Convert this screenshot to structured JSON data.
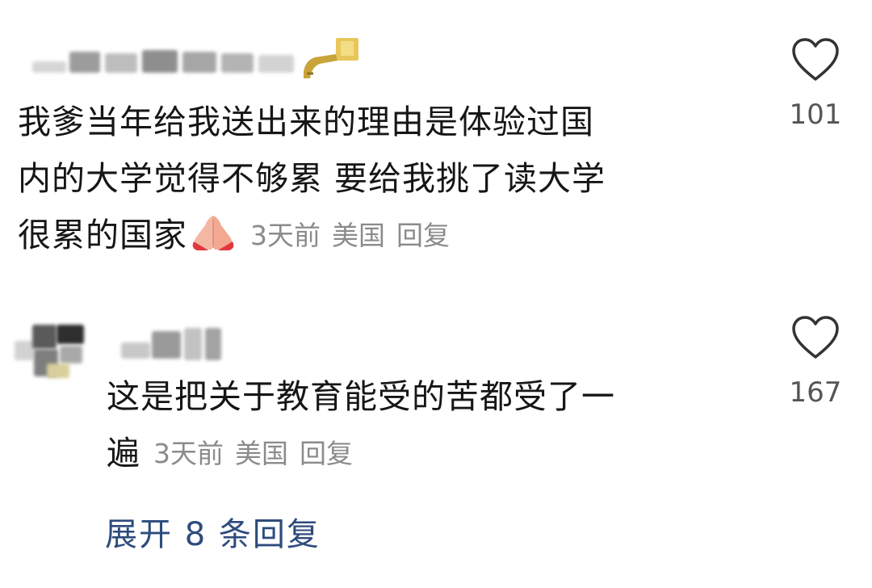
{
  "comments": [
    {
      "text_lines": [
        "我爹当年给我送出来的理由是体验过国",
        "内的大学觉得不够累 要给我挑了读大学",
        "很累的国家"
      ],
      "emoji": "folded-hands-icon",
      "time": "3天前",
      "location": "美国",
      "reply_label": "回复",
      "likes": "101"
    },
    {
      "text_lines": [
        "这是把关于教育能受的苦都受了一",
        "遍"
      ],
      "time": "3天前",
      "location": "美国",
      "reply_label": "回复",
      "likes": "167"
    }
  ],
  "expand_replies": "展开 8 条回复",
  "colors": {
    "text": "#161616",
    "meta": "#8b8b8b",
    "like_count": "#555555",
    "link": "#2e4b7d"
  }
}
